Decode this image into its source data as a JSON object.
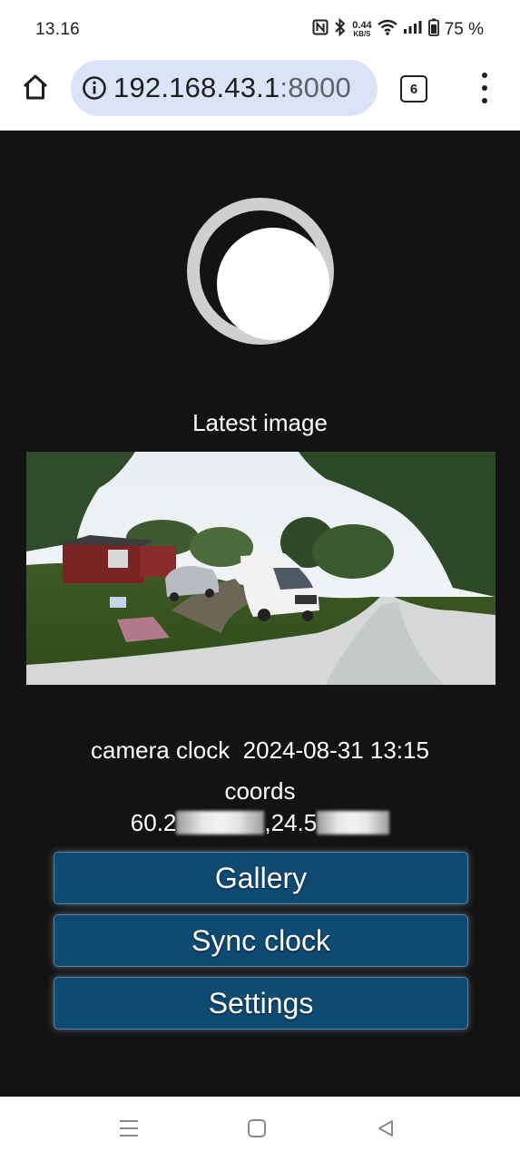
{
  "status_bar": {
    "time": "13.16",
    "speed_value": "0.44",
    "speed_unit": "KB/S",
    "battery": "75 %",
    "icons": [
      "nfc-icon",
      "bluetooth-icon",
      "wifi-icon",
      "signal-icon",
      "battery-icon"
    ]
  },
  "browser": {
    "url_host": "192.168.43.1",
    "url_port": ":8000",
    "tab_count": "6",
    "icons": [
      "home-icon",
      "info-icon",
      "more-vert-icon"
    ]
  },
  "page": {
    "latest_label": "Latest image",
    "clock_label": "camera clock",
    "clock_value": "2024-08-31 13:15",
    "coords_label": "coords",
    "coords_lat_prefix": "60.2",
    "coords_lon_prefix": ",24.5",
    "buttons": {
      "gallery": "Gallery",
      "sync": "Sync clock",
      "settings": "Settings"
    },
    "colors": {
      "background": "#131313",
      "button": "#0f4a73",
      "shutter_ring": "#cfcfcf"
    }
  },
  "nav_bar": {
    "icons": [
      "recents-icon",
      "home-icon",
      "back-icon"
    ]
  }
}
